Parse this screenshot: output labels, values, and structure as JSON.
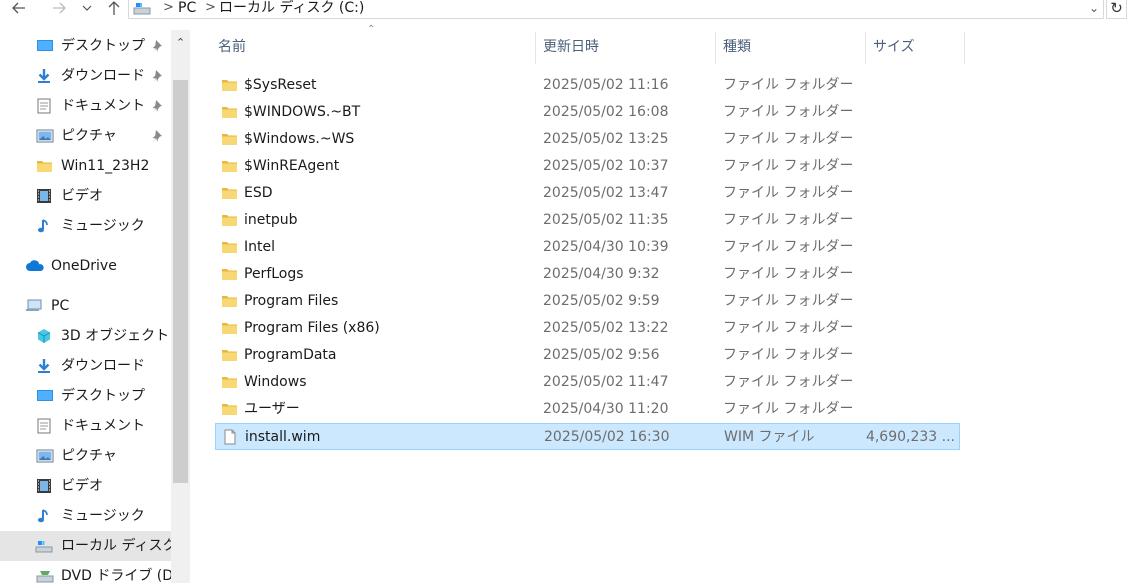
{
  "address": {
    "breadcrumbs": [
      "PC",
      "ローカル ディスク (C:)"
    ]
  },
  "nav": {
    "items": [
      {
        "label": "デスクトップ",
        "icon": "desktop-icon",
        "pinned": true
      },
      {
        "label": "ダウンロード",
        "icon": "download-icon",
        "pinned": true
      },
      {
        "label": "ドキュメント",
        "icon": "document-icon",
        "pinned": true
      },
      {
        "label": "ピクチャ",
        "icon": "pictures-icon",
        "pinned": true
      },
      {
        "label": "Win11_23H2",
        "icon": "folder-icon",
        "pinned": false
      },
      {
        "label": "ビデオ",
        "icon": "video-icon",
        "pinned": false
      },
      {
        "label": "ミュージック",
        "icon": "music-icon",
        "pinned": false
      },
      {
        "label": "OneDrive",
        "icon": "cloud-icon",
        "pinned": false
      },
      {
        "label": "PC",
        "icon": "pc-icon",
        "pinned": false
      },
      {
        "label": "3D オブジェクト",
        "icon": "3d-objects-icon",
        "pinned": false
      },
      {
        "label": "ダウンロード",
        "icon": "download-icon",
        "pinned": false
      },
      {
        "label": "デスクトップ",
        "icon": "desktop-icon",
        "pinned": false
      },
      {
        "label": "ドキュメント",
        "icon": "document-icon",
        "pinned": false
      },
      {
        "label": "ピクチャ",
        "icon": "pictures-icon",
        "pinned": false
      },
      {
        "label": "ビデオ",
        "icon": "video-icon",
        "pinned": false
      },
      {
        "label": "ミュージック",
        "icon": "music-icon",
        "pinned": false
      },
      {
        "label": "ローカル ディスク (C",
        "icon": "drive-icon",
        "pinned": false
      },
      {
        "label": "DVD ドライブ (D:)",
        "icon": "dvd-icon",
        "pinned": false
      }
    ]
  },
  "columns": {
    "name": "名前",
    "date": "更新日時",
    "type": "種類",
    "size": "サイズ"
  },
  "files": [
    {
      "name": "$SysReset",
      "date": "2025/05/02 11:16",
      "type": "ファイル フォルダー",
      "size": "",
      "kind": "folder"
    },
    {
      "name": "$WINDOWS.~BT",
      "date": "2025/05/02 16:08",
      "type": "ファイル フォルダー",
      "size": "",
      "kind": "folder"
    },
    {
      "name": "$Windows.~WS",
      "date": "2025/05/02 13:25",
      "type": "ファイル フォルダー",
      "size": "",
      "kind": "folder"
    },
    {
      "name": "$WinREAgent",
      "date": "2025/05/02 10:37",
      "type": "ファイル フォルダー",
      "size": "",
      "kind": "folder"
    },
    {
      "name": "ESD",
      "date": "2025/05/02 13:47",
      "type": "ファイル フォルダー",
      "size": "",
      "kind": "folder"
    },
    {
      "name": "inetpub",
      "date": "2025/05/02 11:35",
      "type": "ファイル フォルダー",
      "size": "",
      "kind": "folder"
    },
    {
      "name": "Intel",
      "date": "2025/04/30 10:39",
      "type": "ファイル フォルダー",
      "size": "",
      "kind": "folder"
    },
    {
      "name": "PerfLogs",
      "date": "2025/04/30 9:32",
      "type": "ファイル フォルダー",
      "size": "",
      "kind": "folder"
    },
    {
      "name": "Program Files",
      "date": "2025/05/02 9:59",
      "type": "ファイル フォルダー",
      "size": "",
      "kind": "folder"
    },
    {
      "name": "Program Files (x86)",
      "date": "2025/05/02 13:22",
      "type": "ファイル フォルダー",
      "size": "",
      "kind": "folder"
    },
    {
      "name": "ProgramData",
      "date": "2025/05/02 9:56",
      "type": "ファイル フォルダー",
      "size": "",
      "kind": "folder"
    },
    {
      "name": "Windows",
      "date": "2025/05/02 11:47",
      "type": "ファイル フォルダー",
      "size": "",
      "kind": "folder"
    },
    {
      "name": "ユーザー",
      "date": "2025/04/30 11:20",
      "type": "ファイル フォルダー",
      "size": "",
      "kind": "folder"
    },
    {
      "name": "install.wim",
      "date": "2025/05/02 16:30",
      "type": "WIM ファイル",
      "size": "4,690,233 ...",
      "kind": "file"
    }
  ],
  "colors": {
    "selection_bg": "#cce8ff",
    "selection_border": "#99d1ff",
    "folder_yellow": "#f8d775",
    "header_text": "#4c607a"
  }
}
